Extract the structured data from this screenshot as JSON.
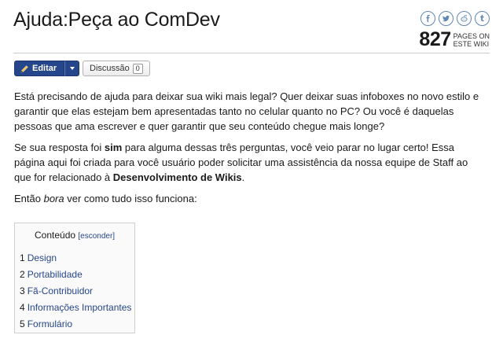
{
  "page": {
    "title": "Ajuda:Peça ao ComDev"
  },
  "social": {
    "icons": [
      "facebook-icon",
      "twitter-icon",
      "reddit-icon",
      "tumblr-icon"
    ]
  },
  "stats": {
    "pages_count": "827",
    "pages_label_line1": "PAGES ON",
    "pages_label_line2": "ESTE WIKI"
  },
  "toolbar": {
    "edit_label": "Editar",
    "talk_label": "Discussão",
    "talk_count": "0"
  },
  "content": {
    "p1": "Está precisando de ajuda para deixar sua wiki mais legal? Quer deixar suas infoboxes no novo estilo e garantir que elas estejam bem apresentadas tanto no celular quanto no PC? Ou você é daquelas pessoas que ama escrever e quer garantir que seu conteúdo chegue mais longe?",
    "p2_part1": "Se sua resposta foi ",
    "p2_bold1": "sim",
    "p2_part2": " para alguma dessas três perguntas, você veio parar no lugar certo! Essa página aqui foi criada para você usuário poder solicitar uma assistência da nossa equipe de Staff ao que for relacionado à ",
    "p2_bold2": "Desenvolvimento de Wikis",
    "p2_part3": ".",
    "p3_part1": "Então ",
    "p3_italic": "bora",
    "p3_part2": " ver como tudo isso funciona:"
  },
  "toc": {
    "title": "Conteúdo",
    "toggle_label": "[esconder]",
    "items": [
      {
        "num": "1",
        "label": "Design"
      },
      {
        "num": "2",
        "label": "Portabilidade"
      },
      {
        "num": "3",
        "label": "Fã-Contribuidor"
      },
      {
        "num": "4",
        "label": "Informações Importantes"
      },
      {
        "num": "5",
        "label": "Formulário"
      }
    ]
  },
  "colors": {
    "link": "#26468c",
    "edit_button": "#26468c"
  }
}
